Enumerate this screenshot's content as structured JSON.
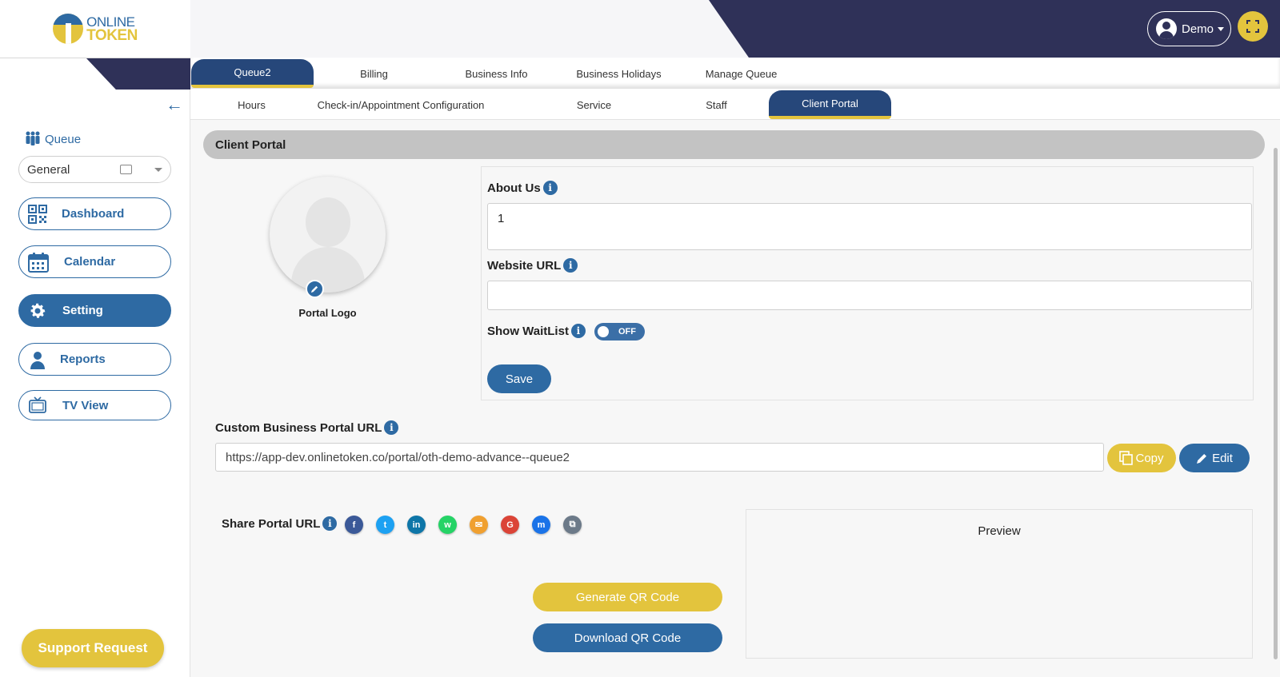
{
  "brand": {
    "line1": "ONLINE",
    "line2": "TOKEN"
  },
  "sidebar": {
    "queue_label": "Queue",
    "queue_select_value": "General",
    "nav": [
      {
        "label": "Dashboard",
        "icon": "qr-code-icon"
      },
      {
        "label": "Calendar",
        "icon": "calendar-icon"
      },
      {
        "label": "Setting",
        "icon": "gear-icon",
        "active": true
      },
      {
        "label": "Reports",
        "icon": "user-icon"
      },
      {
        "label": "TV View",
        "icon": "tv-icon"
      }
    ],
    "support_label": "Support Request"
  },
  "header": {
    "user_label": "Demo"
  },
  "tabs_primary": [
    "Queue2",
    "Billing",
    "Business Info",
    "Business Holidays",
    "Manage Queue"
  ],
  "tabs_secondary": [
    "Hours",
    "Check-in/Appointment Configuration",
    "Service",
    "Staff",
    "Client Portal"
  ],
  "main": {
    "section_title": "Client Portal",
    "portal_logo_label": "Portal Logo",
    "about_label": "About Us",
    "about_value": "1",
    "website_label": "Website URL",
    "website_value": "",
    "waitlist_label": "Show WaitList",
    "waitlist_state": "OFF",
    "save_label": "Save",
    "custom_url_label": "Custom Business Portal URL",
    "custom_url_value": "https://app-dev.onlinetoken.co/portal/oth-demo-advance--queue2",
    "copy_label": "Copy",
    "edit_label": "Edit",
    "share_label": "Share Portal URL",
    "share_icons": [
      {
        "name": "facebook-icon",
        "glyph": "f",
        "color": "#3b5998"
      },
      {
        "name": "twitter-icon",
        "glyph": "t",
        "color": "#1da1f2"
      },
      {
        "name": "linkedin-icon",
        "glyph": "in",
        "color": "#0e76a8"
      },
      {
        "name": "whatsapp-icon",
        "glyph": "w",
        "color": "#25d366"
      },
      {
        "name": "email-icon",
        "glyph": "✉",
        "color": "#f0a030"
      },
      {
        "name": "google-icon",
        "glyph": "G",
        "color": "#db4437"
      },
      {
        "name": "messenger-icon",
        "glyph": "m",
        "color": "#1a73e8"
      },
      {
        "name": "copy-link-icon",
        "glyph": "⧉",
        "color": "#6c7a89"
      }
    ],
    "generate_qr_label": "Generate QR Code",
    "download_qr_label": "Download QR Code",
    "preview_label": "Preview"
  },
  "colors": {
    "navy": "#2f3158",
    "blue": "#2e6aa3",
    "gold": "#e3c43d",
    "tab_active": "#26477a"
  }
}
